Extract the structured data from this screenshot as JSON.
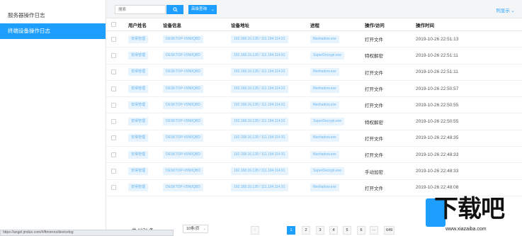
{
  "sidebar": {
    "items": [
      {
        "label": "服务器操作日志",
        "active": false
      },
      {
        "label": "终端设备操作日志",
        "active": true
      }
    ]
  },
  "toolbar": {
    "search_placeholder": "搜索",
    "search_icon": "search-icon",
    "advanced_label": "高级查询",
    "column_display_label": "列显示"
  },
  "table": {
    "headers": {
      "user": "用户姓名",
      "device": "设备信息",
      "address": "设备地址",
      "process": "进程",
      "action": "操作/访问",
      "time": "操作时间"
    },
    "rows": [
      {
        "user": "安得管理",
        "device": "DESKTOP-V9N0QBD",
        "address": "192.168.16.128 / 111.194.114.91",
        "process": "fileshadow.exe",
        "action": "打开文件",
        "time": "2019-10-26 22:51:13"
      },
      {
        "user": "安得管理",
        "device": "DESKTOP-V9N0QBD",
        "address": "192.168.16.128 / 111.194.114.91",
        "process": "SuperDecrypt.exe",
        "action": "特权解密",
        "time": "2019-10-26 22:51:11"
      },
      {
        "user": "安得管理",
        "device": "DESKTOP-V9N0QBD",
        "address": "192.168.16.128 / 111.194.114.91",
        "process": "fileshadow.exe",
        "action": "打开文件",
        "time": "2019-10-26 22:51:11"
      },
      {
        "user": "安得管理",
        "device": "DESKTOP-V9N0QBD",
        "address": "192.168.16.128 / 111.194.114.91",
        "process": "fileshadow.exe",
        "action": "打开文件",
        "time": "2019-10-26 22:50:57"
      },
      {
        "user": "安得管理",
        "device": "DESKTOP-V9N0QBD",
        "address": "192.168.16.128 / 111.194.114.91",
        "process": "fileshadow.exe",
        "action": "打开文件",
        "time": "2019-10-26 22:50:55"
      },
      {
        "user": "安得管理",
        "device": "DESKTOP-V9N0QBD",
        "address": "192.168.16.128 / 111.194.114.91",
        "process": "SuperDecrypt.exe",
        "action": "特权解密",
        "time": "2019-10-26 22:50:55"
      },
      {
        "user": "安得管理",
        "device": "DESKTOP-V9N0QBD",
        "address": "192.168.16.128 / 111.194.114.91",
        "process": "fileshadow.exe",
        "action": "打开文件",
        "time": "2019-10-26 22:48:35"
      },
      {
        "user": "安得管理",
        "device": "DESKTOP-V9N0QBD",
        "address": "192.168.16.128 / 111.194.114.91",
        "process": "fileshadow.exe",
        "action": "打开文件",
        "time": "2019-10-26 22:48:33"
      },
      {
        "user": "安得管理",
        "device": "DESKTOP-V9N0QBD",
        "address": "192.168.16.128 / 111.194.114.91",
        "process": "SuperDecrypt.exe",
        "action": "手动加密",
        "time": "2019-10-26 22:48:33"
      },
      {
        "user": "安得管理",
        "device": "DESKTOP-V9N0QBD",
        "address": "192.168.16.128 / 111.194.114.91",
        "process": "fileshadow.exe",
        "action": "打开文件",
        "time": "2019-10-26 22:48:08"
      }
    ]
  },
  "pagination": {
    "total_label": "共 1271 条",
    "page_size": "10条/页",
    "prev": "‹",
    "pages": [
      "1",
      "2",
      "3",
      "4",
      "5",
      "6",
      "···",
      "649"
    ],
    "current": "1"
  },
  "statusbar": {
    "url": "https://angel.jmdun.com/#/ftmirrors/devicelog"
  },
  "watermark": {
    "text": "下载吧",
    "url": "www.xiazaiba.com"
  },
  "colors": {
    "accent": "#1e9fff",
    "tag_bg": "#e8f4fd",
    "tag_text": "#6bb6ef"
  }
}
